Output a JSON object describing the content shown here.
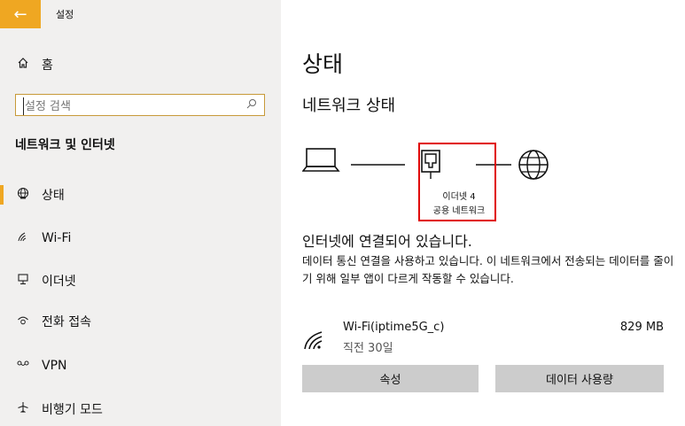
{
  "app": {
    "title": "설정",
    "back_icon": "arrow-left-icon"
  },
  "sidebar": {
    "home": {
      "label": "홈",
      "icon": "home-icon"
    },
    "search": {
      "placeholder": "설정 검색",
      "value": ""
    },
    "section_title": "네트워크 및 인터넷",
    "items": [
      {
        "label": "상태",
        "icon": "globe-icon",
        "active": true
      },
      {
        "label": "Wi-Fi",
        "icon": "wifi-icon",
        "active": false
      },
      {
        "label": "이더넷",
        "icon": "ethernet-icon",
        "active": false
      },
      {
        "label": "전화 접속",
        "icon": "dialup-icon",
        "active": false
      },
      {
        "label": "VPN",
        "icon": "vpn-icon",
        "active": false
      },
      {
        "label": "비행기 모드",
        "icon": "airplane-icon",
        "active": false
      }
    ]
  },
  "main": {
    "page_title": "상태",
    "sub_title": "네트워크 상태",
    "diagram": {
      "adapter_name": "이더넷 4",
      "network_name": "공용 네트워크"
    },
    "connected_text": "인터넷에 연결되어 있습니다.",
    "description": "데이터 통신 연결을 사용하고 있습니다. 이 네트워크에서 전송되는 데이터를 줄이기 위해 일부 앱이 다르게 작동할 수 있습니다.",
    "wifi": {
      "name": "Wi-Fi(iptime5G_c)",
      "time": "직전 30일",
      "data": "829 MB"
    },
    "buttons": {
      "properties": "속성",
      "data_usage": "데이터 사용량"
    }
  },
  "colors": {
    "accent": "#efa722",
    "highlight_border": "#e00000",
    "sidebar_bg": "#f1f0ef",
    "button_bg": "#cccccc"
  }
}
